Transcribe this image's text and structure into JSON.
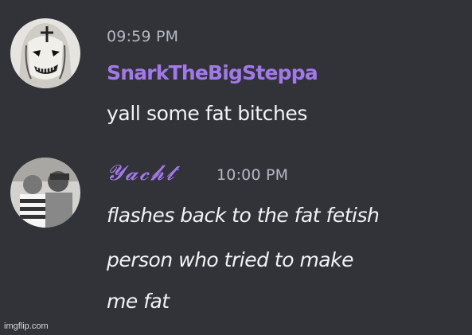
{
  "messages": [
    {
      "timestamp": "09:59 PM",
      "username": "SnarkTheBigSteppa",
      "text": "yall some fat bitches",
      "avatar": "masked-figure-avatar"
    },
    {
      "timestamp": "10:00 PM",
      "username": "𝓨𝓪𝓬𝓱𝓽",
      "lines": [
        "flashes back to the fat fetish",
        "person who tried to make",
        "me fat"
      ],
      "avatar": "group-photo-avatar"
    }
  ],
  "watermark": "imgflip.com",
  "colors": {
    "background": "#313338",
    "username": "#a279e8",
    "timestamp": "#b5bac1",
    "text": "#f2f3f5"
  }
}
